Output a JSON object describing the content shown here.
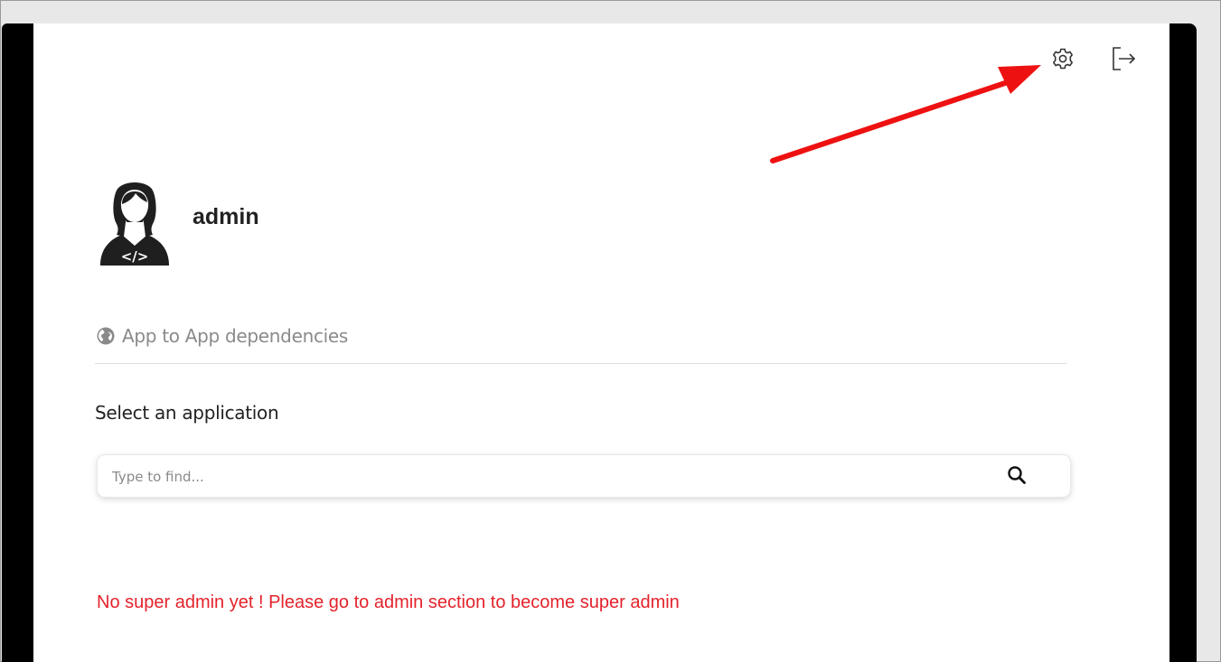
{
  "user": {
    "name": "admin"
  },
  "header": {
    "settings_icon": "gear-icon",
    "logout_icon": "logout-icon"
  },
  "nav": {
    "icon": "globe-icon",
    "label": "App to App dependencies"
  },
  "selector": {
    "title": "Select an application",
    "placeholder": "Type to find...",
    "value": ""
  },
  "warning": {
    "text": "No super admin yet ! Please go to admin section to become super admin",
    "color": "#e3232b"
  },
  "annotation": {
    "color": "#ee1111"
  }
}
